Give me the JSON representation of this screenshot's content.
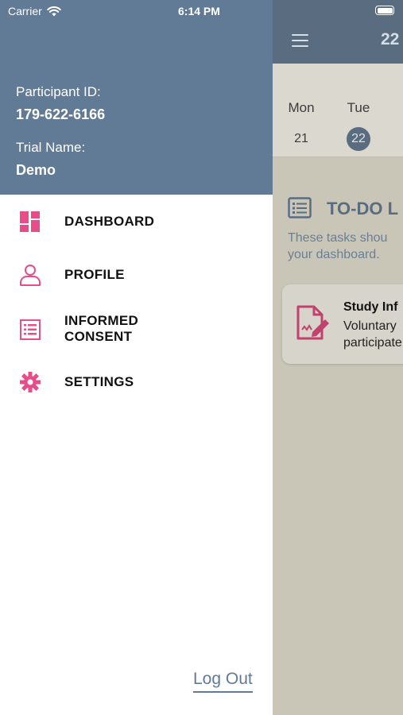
{
  "status_bar": {
    "carrier": "Carrier",
    "time": "6:14 PM"
  },
  "drawer": {
    "participant_label": "Participant ID:",
    "participant_id": "179-622-6166",
    "trial_label": "Trial Name:",
    "trial_name": "Demo",
    "items": [
      {
        "label": "DASHBOARD",
        "icon": "dashboard-icon"
      },
      {
        "label": "PROFILE",
        "icon": "person-icon"
      },
      {
        "label": "INFORMED\nCONSENT",
        "icon": "list-icon"
      },
      {
        "label": "SETTINGS",
        "icon": "gear-icon"
      }
    ],
    "logout": "Log Out"
  },
  "background": {
    "header_date": "22",
    "week": [
      {
        "day": "Mon",
        "num": "21",
        "selected": false
      },
      {
        "day": "Tue",
        "num": "22",
        "selected": true
      }
    ],
    "todo_title": "TO-DO L",
    "todo_desc": "These tasks shou your dashboard.",
    "card_title": "Study Inf",
    "card_line1": "Voluntary",
    "card_line2": "participate"
  },
  "colors": {
    "header": "#617B96",
    "accent": "#E84D8A",
    "dim_header": "#5A6C7F",
    "dim_bg": "#C9C6B8"
  }
}
